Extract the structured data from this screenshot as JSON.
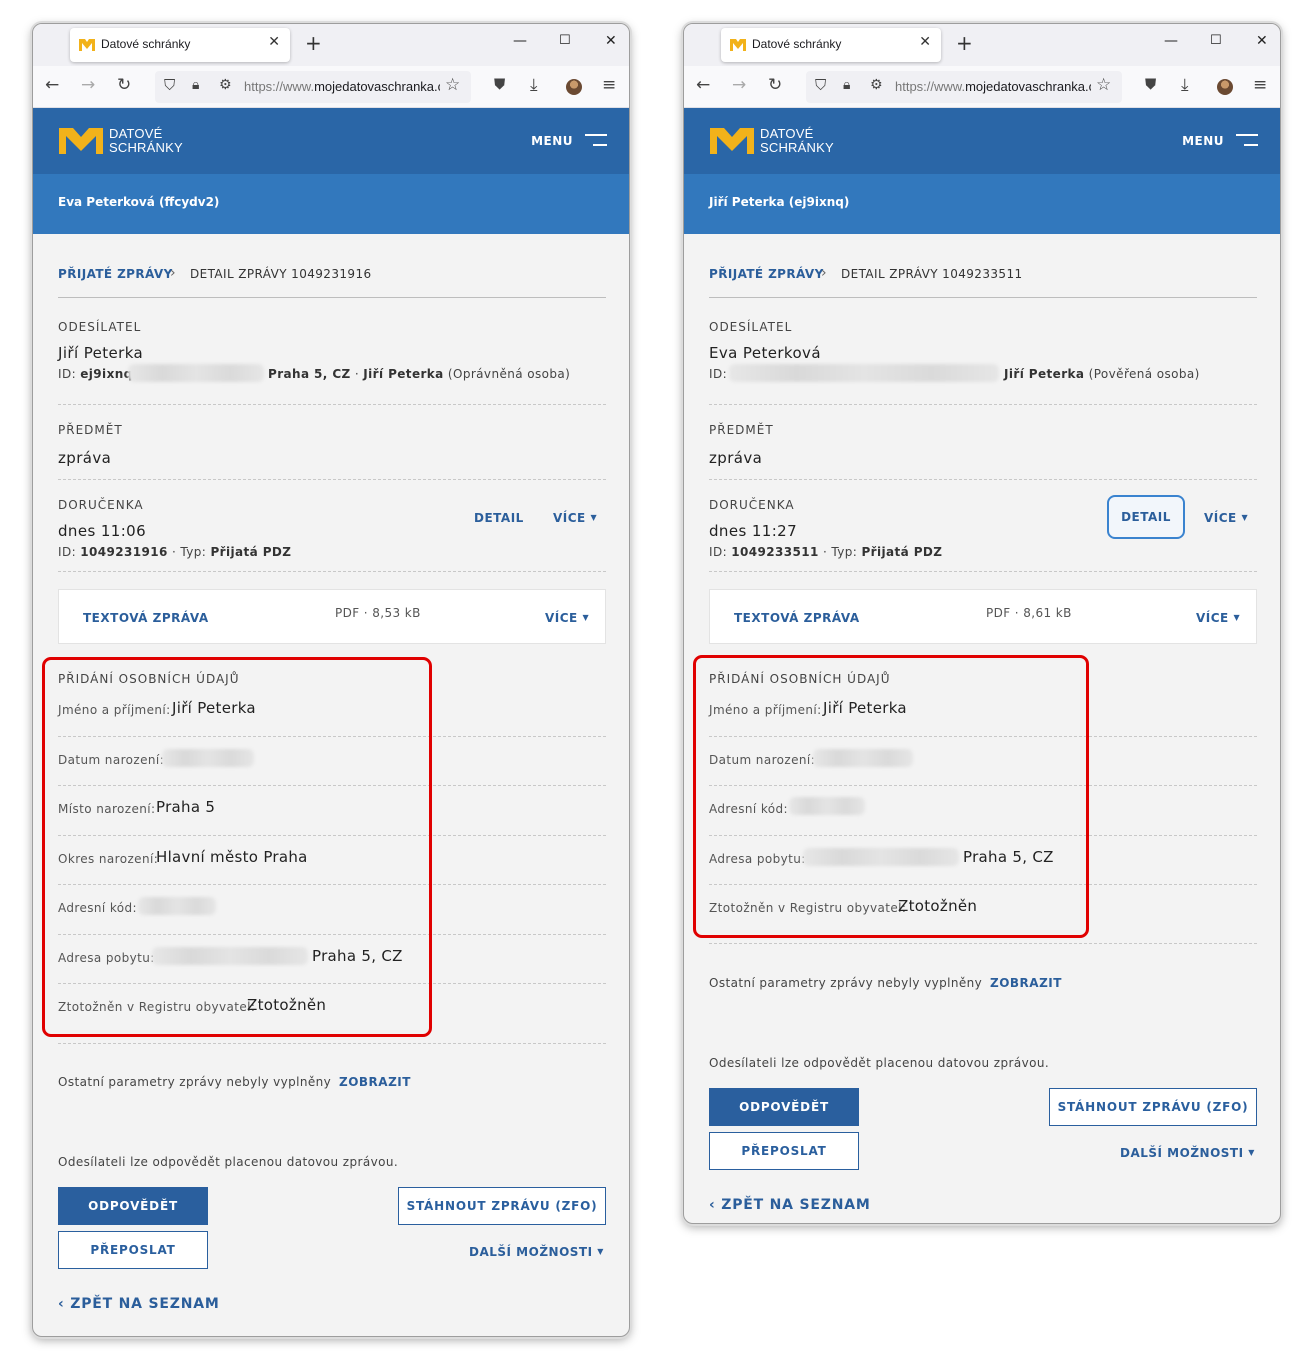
{
  "colors": {
    "header_blue": "#2a66a7",
    "user_bar_blue": "#3278bd",
    "link_blue": "#2b5e9b",
    "highlight_red": "#e00000",
    "logo_yellow": "#f2b21a"
  },
  "browser": {
    "tab_title": "Datové schránky",
    "url_prefix": "https://www.",
    "url_host": "mojedatovaschranka.cz",
    "icons": [
      "back-arrow-icon",
      "forward-arrow-icon",
      "reload-icon",
      "shield-icon",
      "lock-icon",
      "permissions-icon",
      "star-icon",
      "pocket-icon",
      "download-icon",
      "profile-avatar",
      "hamburger-icon"
    ]
  },
  "site": {
    "logo_line1": "DATOVÉ",
    "logo_line2": "SCHRÁNKY",
    "menu_label": "MENU"
  },
  "common": {
    "breadcrumb_parent": "PŘIJATÉ ZPRÁVY",
    "sender_heading": "ODESÍLATEL",
    "subject_heading": "PŘEDMĚT",
    "receipt_heading": "DORUČENKA",
    "detail_label": "DETAIL",
    "more_label": "VÍCE",
    "attachment_name": "TEXTOVÁ ZPRÁVA",
    "personal_heading": "PŘIDÁNÍ OSOBNÍCH ÚDAJŮ",
    "other_params_text": "Ostatní parametry zprávy nebyly vyplněny",
    "show_label": "ZOBRAZIT",
    "paid_reply_text": "Odesílateli lze odpovědět placenou datovou zprávou.",
    "reply_label": "ODPOVĚDĚT",
    "forward_label": "PŘEPOSLAT",
    "download_label": "STÁHNOUT ZPRÁVU (ZFO)",
    "more_options_label": "DALŠÍ MOŽNOSTI",
    "back_label": "ZPĚT NA SEZNAM"
  },
  "windows": [
    {
      "user": "Eva Peterková (ffcydv2)",
      "breadcrumb_current": "DETAIL ZPRÁVY 1049231916",
      "sender_name": "Jiří Peterka",
      "sender_id_label": "ID:",
      "sender_id": "ej9ixnq",
      "sender_location": "Praha 5, CZ",
      "sender_dot": "·",
      "sender_person": "Jiří Peterka",
      "sender_role": "(Oprávněná osoba)",
      "subject": "zpráva",
      "receipt_time": "dnes 11:06",
      "receipt_id_label": "ID:",
      "receipt_id": "1049231916",
      "receipt_type_label": "· Typ:",
      "receipt_type": "Přijatá PDZ",
      "attachment_meta": "PDF · 8,53 kB",
      "fields": [
        {
          "label": "Jméno a příjmení:",
          "value": "Jiří Peterka"
        },
        {
          "label": "Datum narození:",
          "value": ""
        },
        {
          "label": "Místo narození:",
          "value": "Praha 5"
        },
        {
          "label": "Okres narození:",
          "value": "Hlavní město Praha"
        },
        {
          "label": "Adresní kód:",
          "value": ""
        },
        {
          "label": "Adresa pobytu:",
          "value": "Praha 5, CZ"
        },
        {
          "label": "Ztotožněn v Registru obyvatel:",
          "value": "Ztotožněn"
        }
      ]
    },
    {
      "user": "Jiří Peterka (ej9ixnq)",
      "breadcrumb_current": "DETAIL ZPRÁVY 1049233511",
      "sender_name": "Eva Peterková",
      "sender_id_label": "ID:",
      "sender_person": "Jiří Peterka",
      "sender_role": "(Pověřená osoba)",
      "subject": "zpráva",
      "receipt_time": "dnes 11:27",
      "receipt_id_label": "ID:",
      "receipt_id": "1049233511",
      "receipt_type_label": "· Typ:",
      "receipt_type": "Přijatá PDZ",
      "attachment_meta": "PDF · 8,61 kB",
      "fields": [
        {
          "label": "Jméno a příjmení:",
          "value": "Jiří Peterka"
        },
        {
          "label": "Datum narození:",
          "value": ""
        },
        {
          "label": "Adresní kód:",
          "value": ""
        },
        {
          "label": "Adresa pobytu:",
          "value": "Praha 5, CZ"
        },
        {
          "label": "Ztotožněn v Registru obyvatel:",
          "value": "Ztotožněn"
        }
      ]
    }
  ]
}
